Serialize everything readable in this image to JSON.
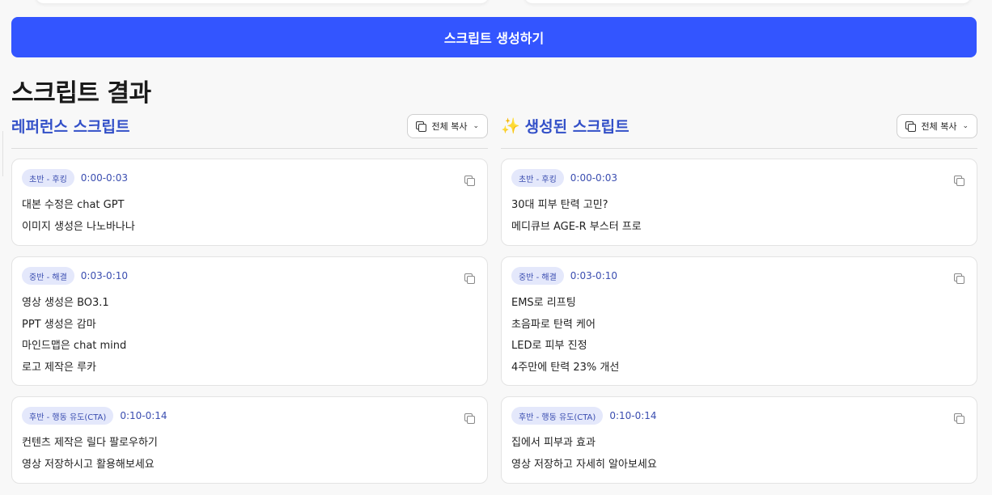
{
  "generate_button": {
    "label": "스크립트 생성하기"
  },
  "section_title": "스크립트 결과",
  "copy_all_label": "전체 복사",
  "reference": {
    "title": "레퍼런스 스크립트",
    "cards": [
      {
        "badge": "초반 - 후킹",
        "time": "0:00-0:03",
        "lines": [
          "대본 수정은 chat GPT",
          "이미지 생성은 나노바나나"
        ]
      },
      {
        "badge": "중반 - 해결",
        "time": "0:03-0:10",
        "lines": [
          "영상 생성은 BO3.1",
          "PPT 생성은 감마",
          "마인드맵은 chat mind",
          "로고 제작은 루카"
        ]
      },
      {
        "badge": "후반 - 행동 유도(CTA)",
        "time": "0:10-0:14",
        "lines": [
          "컨텐츠 제작은 릴다 팔로우하기",
          "영상 저장하시고 활용해보세요"
        ]
      }
    ]
  },
  "generated": {
    "title": "생성된 스크립트",
    "title_icon": "sparkle-icon",
    "cards": [
      {
        "badge": "초반 - 후킹",
        "time": "0:00-0:03",
        "lines": [
          "30대 피부 탄력 고민?",
          "메디큐브 AGE-R 부스터 프로"
        ]
      },
      {
        "badge": "중반 - 해결",
        "time": "0:03-0:10",
        "lines": [
          "EMS로 리프팅",
          "초음파로 탄력 케어",
          "LED로 피부 진정",
          "4주만에 탄력 23% 개선"
        ]
      },
      {
        "badge": "후반 - 행동 유도(CTA)",
        "time": "0:10-0:14",
        "lines": [
          "집에서 피부과 효과",
          "영상 저장하고 자세히 알아보세요"
        ]
      }
    ]
  },
  "colors": {
    "primary": "#3355ff",
    "accent_text": "#3350c8",
    "badge_bg": "#e4e8fb"
  }
}
